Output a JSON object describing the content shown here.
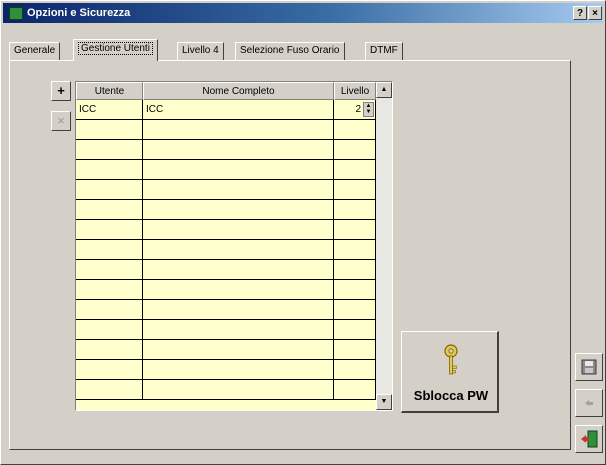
{
  "window": {
    "title": "Opzioni e Sicurezza"
  },
  "titlebar": {
    "help_label": "?",
    "close_label": "×"
  },
  "tabs": [
    {
      "label": "Generale"
    },
    {
      "label": "Gestione Utenti"
    },
    {
      "label": "Livello 4"
    },
    {
      "label": "Selezione Fuso Orario"
    },
    {
      "label": "DTMF"
    }
  ],
  "active_tab": "Gestione Utenti",
  "grid": {
    "columns": [
      "Utente",
      "Nome Completo",
      "Livello"
    ],
    "rows": [
      {
        "utente": "ICC",
        "nome": "ICC",
        "livello": "2"
      }
    ]
  },
  "buttons": {
    "add": "+",
    "delete": "×",
    "unlock": "Sblocca PW"
  },
  "colors": {
    "grid_background": "#ffffcc",
    "key_icon": "#e6c84a",
    "exit_icon": "#2f8f3a"
  }
}
